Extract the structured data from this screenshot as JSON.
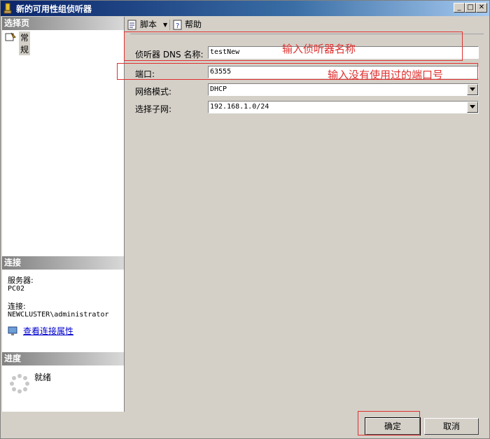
{
  "window": {
    "title": "新的可用性组侦听器"
  },
  "left_panel": {
    "select_page_header": "选择页",
    "pages": [
      {
        "label": "常规"
      }
    ],
    "connection_header": "连接",
    "server_label": "服务器:",
    "server_value": "PC02",
    "connection_label": "连接:",
    "connection_value": "NEWCLUSTER\\administrator",
    "view_connection_link": "查看连接属性",
    "progress_header": "进度",
    "progress_status": "就绪"
  },
  "toolbar": {
    "script_label": "脚本",
    "help_label": "帮助"
  },
  "form": {
    "dns_name": {
      "label": "侦听器 DNS 名称:",
      "value": "testNew"
    },
    "port": {
      "label": "端口:",
      "value": "63555"
    },
    "network_mode": {
      "label": "网络模式:",
      "value": "DHCP"
    },
    "subnet": {
      "label": "选择子网:",
      "value": "192.168.1.0/24"
    }
  },
  "annotations": {
    "dns_hint": "输入侦听器名称",
    "port_hint": "输入没有使用过的端口号"
  },
  "buttons": {
    "ok_label": "确定",
    "cancel_label": "取消"
  },
  "colors": {
    "annotation": "#e03030",
    "title_bar": "#0a246a"
  }
}
